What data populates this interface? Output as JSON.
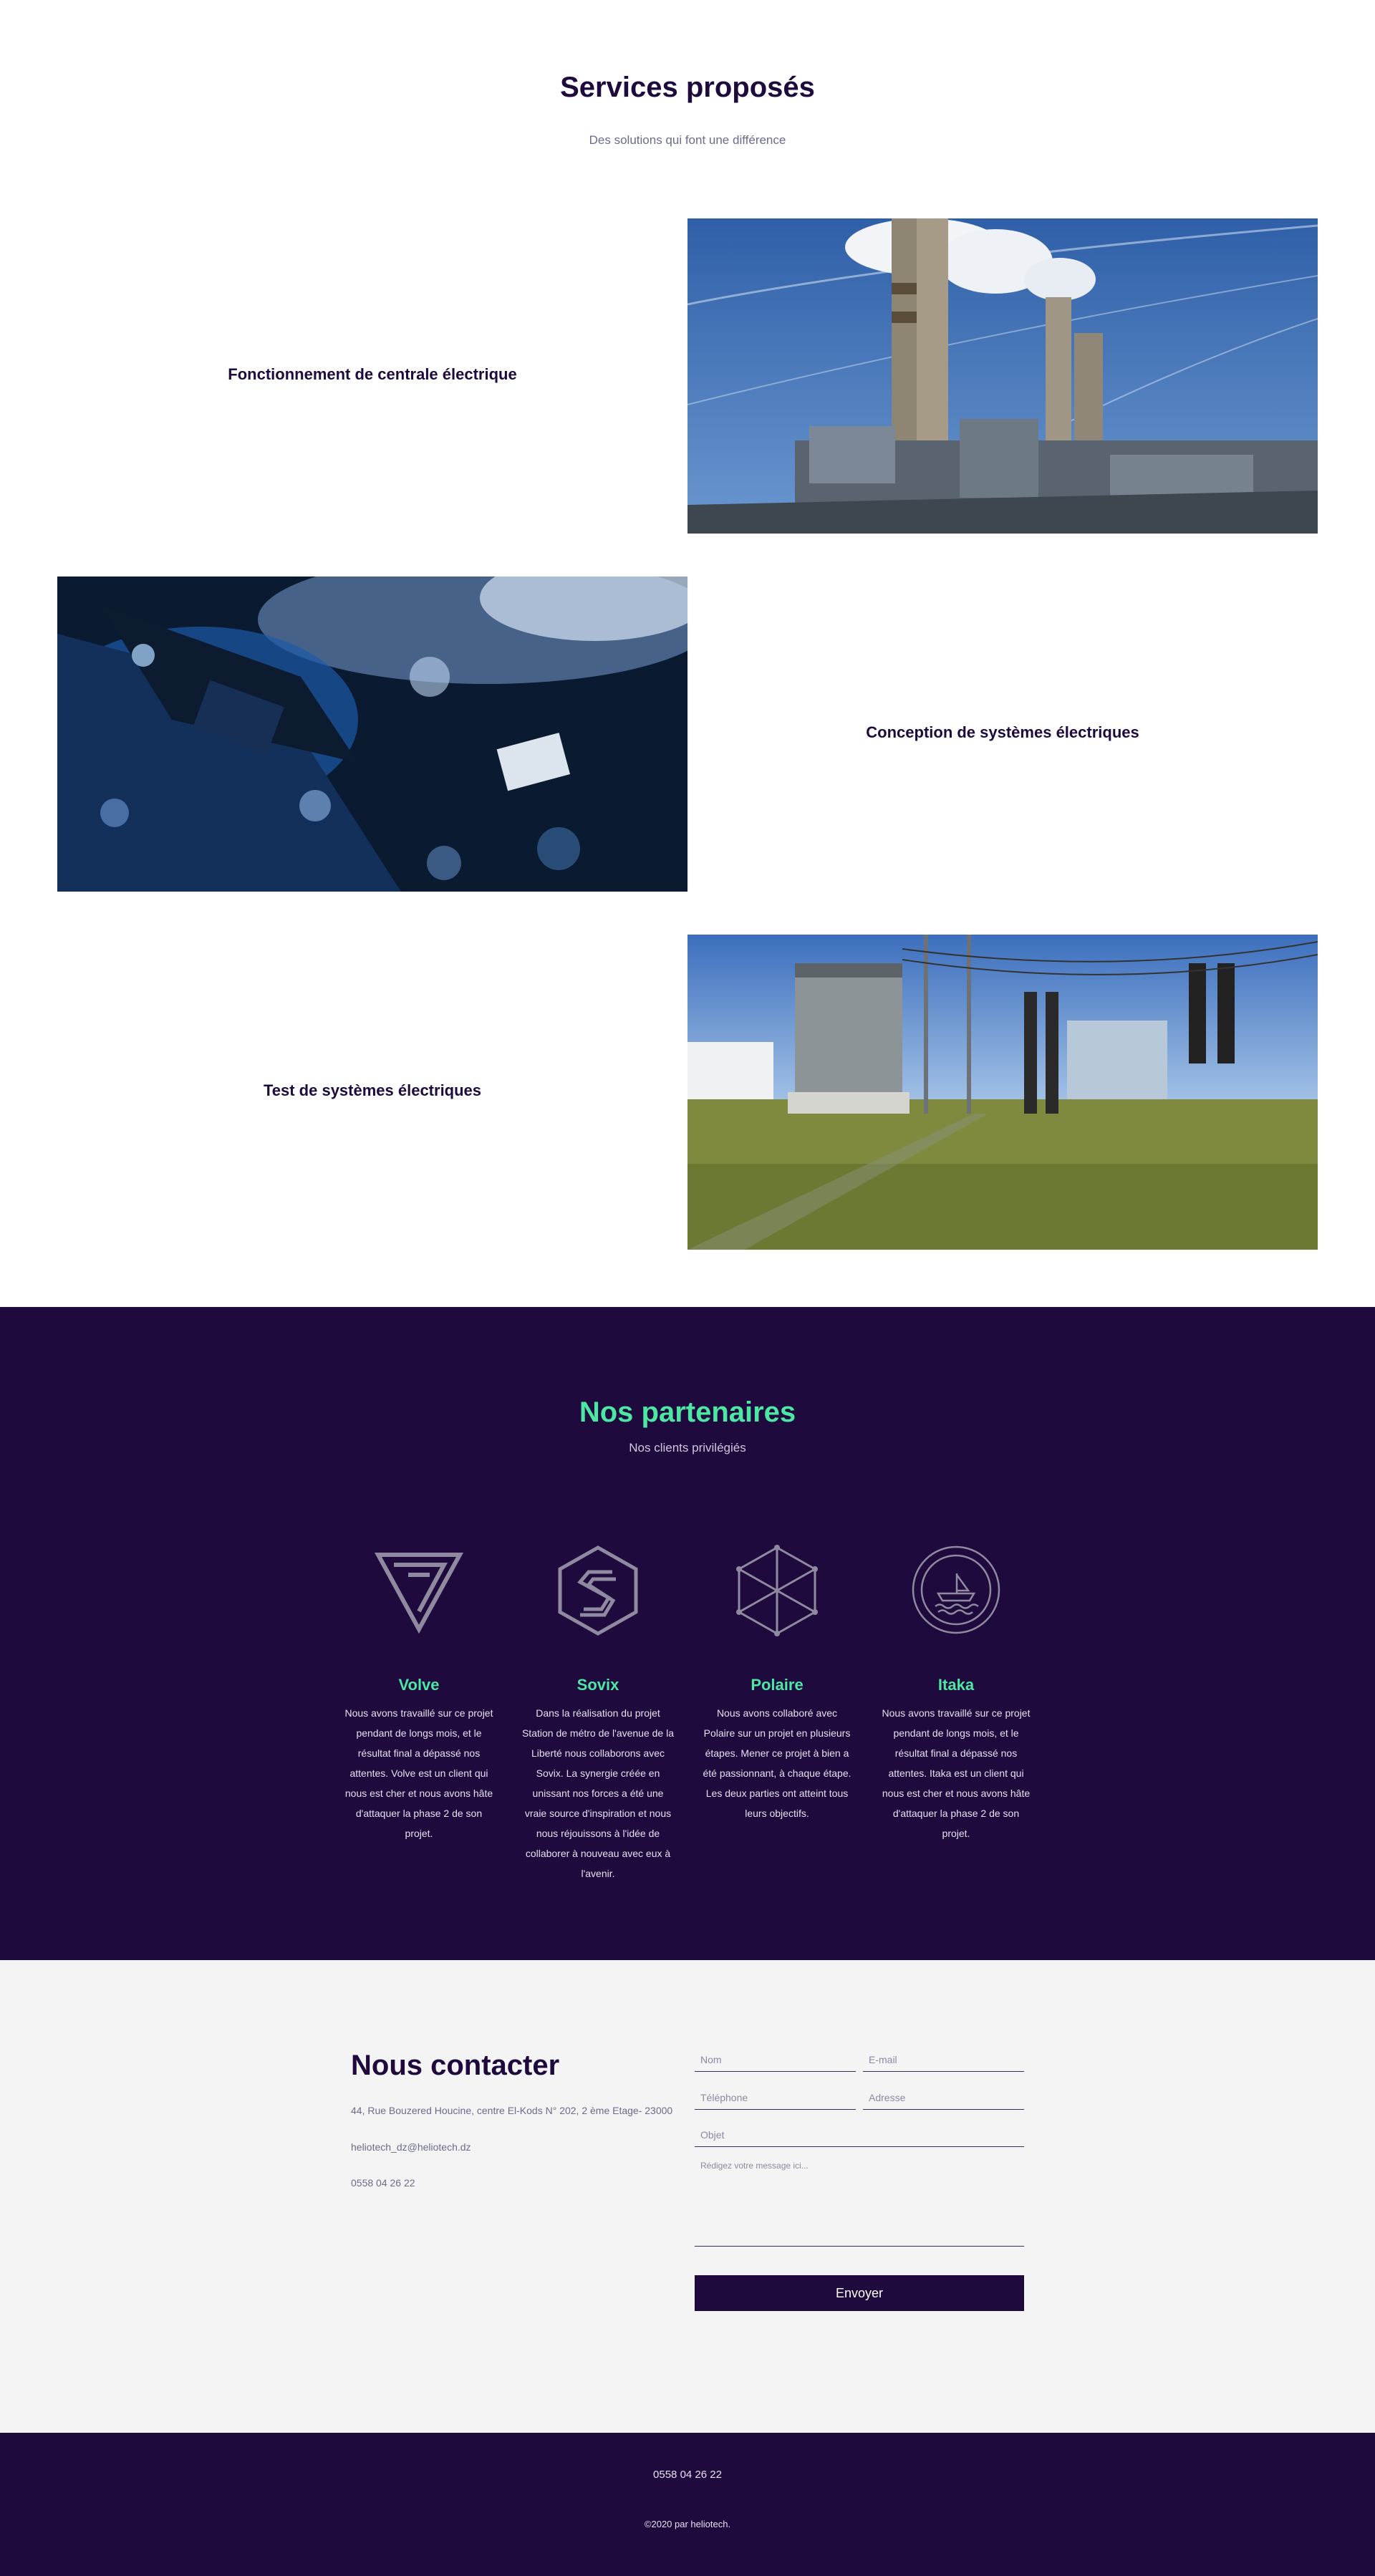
{
  "services": {
    "title": "Services proposés",
    "subtitle": "Des solutions qui font une différence",
    "items": [
      {
        "label": "Fonctionnement de centrale électrique",
        "image": "power-plant-chimneys"
      },
      {
        "label": "Conception de systèmes électriques",
        "image": "circuit-board"
      },
      {
        "label": "Test de systèmes électriques",
        "image": "electrical-substation"
      }
    ]
  },
  "partners": {
    "title": "Nos partenaires",
    "subtitle": "Nos clients privilégiés",
    "items": [
      {
        "name": "Volve",
        "icon": "volve-logo-icon",
        "description": "Nous avons travaillé sur ce projet pendant de longs mois, et le résultat final a dépassé nos attentes. Volve est un client qui nous est cher et nous avons hâte d'attaquer la phase 2 de son projet."
      },
      {
        "name": "Sovix",
        "icon": "sovix-logo-icon",
        "description": "Dans la réalisation du projet Station de métro de l'avenue de la Liberté nous collaborons avec Sovix. La synergie créée en unissant nos forces a été une vraie source d'inspiration et nous nous réjouissons à l'idée de collaborer à nouveau avec eux à l'avenir."
      },
      {
        "name": "Polaire",
        "icon": "polaire-logo-icon",
        "description": "Nous avons collaboré avec Polaire sur un projet en plusieurs étapes. Mener ce projet à bien a été passionnant, à chaque étape. Les deux parties ont atteint tous leurs objectifs."
      },
      {
        "name": "Itaka",
        "icon": "itaka-logo-icon",
        "description": "Nous avons travaillé sur ce projet pendant de longs mois, et le résultat final a dépassé nos attentes. Itaka est un client qui nous est cher et nous avons hâte d'attaquer la phase 2 de son projet."
      }
    ]
  },
  "contact": {
    "title": "Nous contacter",
    "address": "44, Rue Bouzered Houcine, centre El-Kods N° 202, 2 ème Etage- 23000",
    "email": "heliotech_dz@heliotech.dz",
    "phone": "0558 04 26 22",
    "form": {
      "name_placeholder": "Nom",
      "email_placeholder": "E-mail",
      "phone_placeholder": "Téléphone",
      "address_placeholder": "Adresse",
      "subject_placeholder": "Objet",
      "message_placeholder": "Rédigez votre message ici...",
      "submit_label": "Envoyer"
    }
  },
  "footer": {
    "phone": "0558 04 26 22",
    "copyright": "©2020 par heliotech."
  },
  "colors": {
    "navy": "#1e0a3c",
    "accent_green": "#4ee6a3",
    "light_gray_bg": "#f4f4f5"
  }
}
